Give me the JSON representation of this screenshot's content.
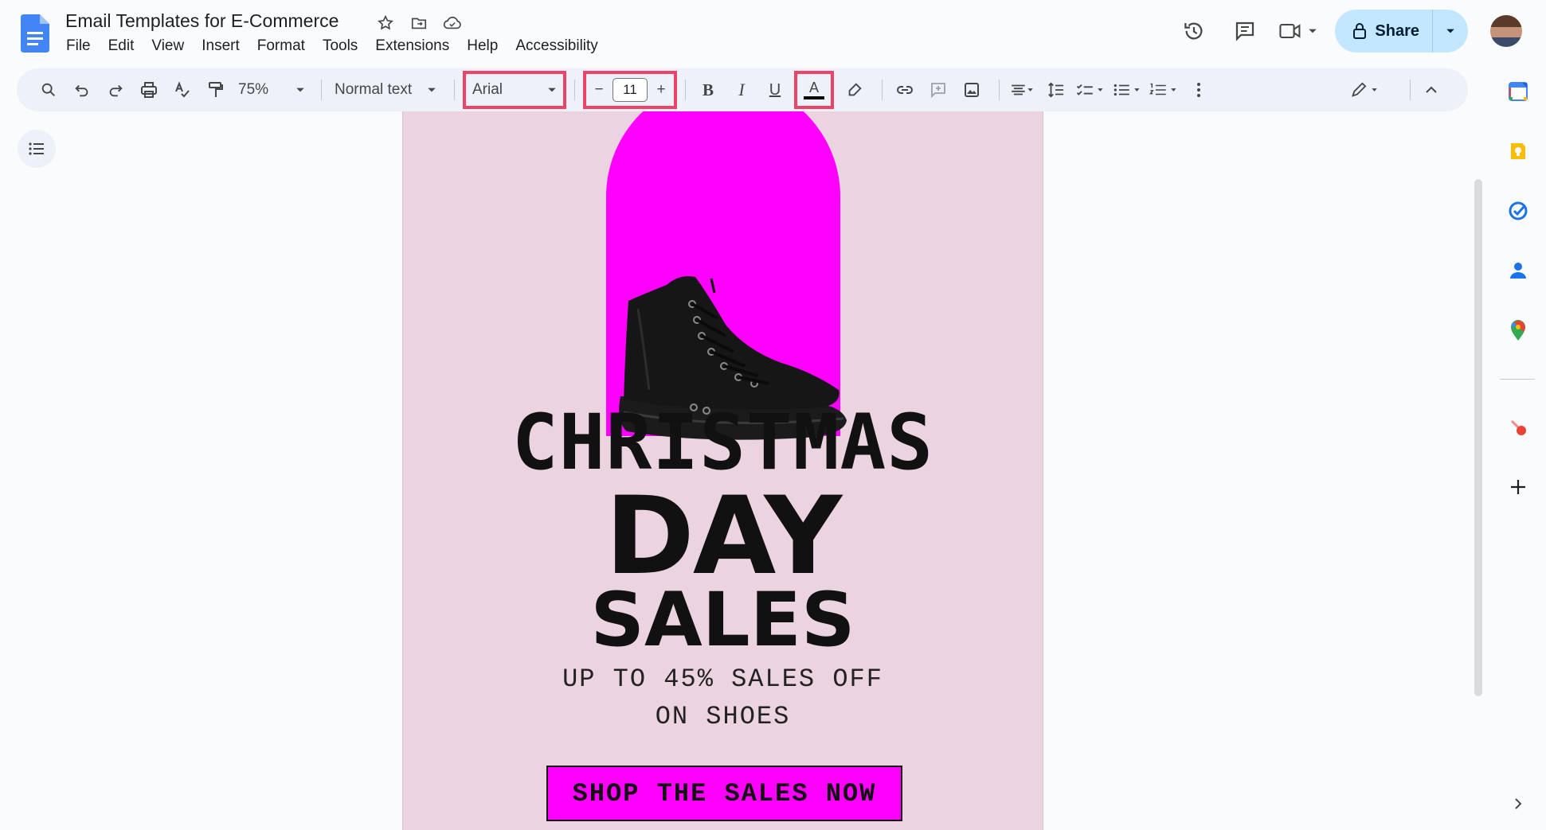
{
  "header": {
    "title": "Email Templates for E-Commerce",
    "menu": [
      "File",
      "Edit",
      "View",
      "Insert",
      "Format",
      "Tools",
      "Extensions",
      "Help",
      "Accessibility"
    ],
    "share_label": "Share"
  },
  "toolbar": {
    "zoom": "75%",
    "paragraph_style": "Normal text",
    "font": "Arial",
    "font_size": "11",
    "text_color_glyph": "A",
    "bold_glyph": "B",
    "italic_glyph": "I",
    "underline_glyph": "U",
    "decrease_glyph": "−",
    "increase_glyph": "+"
  },
  "document": {
    "headline_1": "CHRISTMAS",
    "headline_2": "DAY",
    "headline_3": "SALES",
    "subline_1": "UP TO 45% SALES OFF",
    "subline_2": "ON SHOES",
    "cta_label": "SHOP THE SALES NOW"
  },
  "colors": {
    "highlight_border": "#ef4268",
    "page_background": "#ebd3e0",
    "accent_magenta": "#ff00ff",
    "share_button": "#c2e7ff"
  },
  "icons": [
    "docs-logo-icon",
    "star-icon",
    "move-to-folder-icon",
    "cloud-status-icon",
    "version-history-icon",
    "comments-icon",
    "meet-icon",
    "lock-icon",
    "search-icon",
    "undo-icon",
    "redo-icon",
    "print-icon",
    "spellcheck-icon",
    "paint-format-icon",
    "highlight-icon",
    "link-icon",
    "add-comment-icon",
    "insert-image-icon",
    "align-icon",
    "line-spacing-icon",
    "checklist-icon",
    "bulleted-list-icon",
    "numbered-list-icon",
    "more-icon",
    "edit-mode-icon",
    "collapse-icon",
    "outline-icon",
    "calendar-icon",
    "keep-icon",
    "tasks-icon",
    "contacts-icon",
    "maps-icon",
    "addon-icon",
    "add-icon",
    "chevron-right-icon"
  ]
}
